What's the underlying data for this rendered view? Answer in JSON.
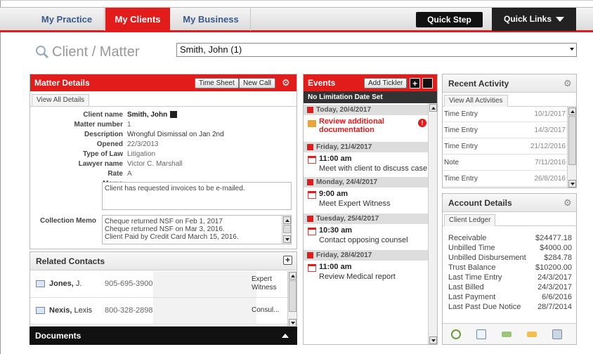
{
  "nav": {
    "tabs": [
      "My Practice",
      "My Clients",
      "My Business"
    ],
    "quick_step": "Quick Step",
    "quick_links": "Quick Links"
  },
  "client_matter": {
    "title": "Client / Matter",
    "value": "Smith, John (1)"
  },
  "matter_details": {
    "title": "Matter Details",
    "time_sheet": "Time Sheet",
    "new_call": "New Call",
    "view_all": "View All Details",
    "client_name_label": "Client name",
    "client_name": "Smith, John",
    "matter_number_label": "Matter number",
    "matter_number": "1",
    "description_label": "Description",
    "description": "Wrongful Dismissal on Jan 2nd",
    "opened_label": "Opened",
    "opened": "22/3/2013",
    "type_label": "Type of Law",
    "type": "Litigation",
    "lawyer_label": "Lawyer name",
    "lawyer": "Victor C. Marshall",
    "rate_label": "Rate",
    "rate": "A",
    "memo_label": "Memo",
    "memo": "Client has requested invoices to be e-mailed.",
    "collection_label": "Collection Memo",
    "collection_lines": [
      "Cheque returned NSF on Feb 1, 2017",
      "Cheque returned NSF on Mar 3, 2016.",
      "Client Paid by Credit Card March 15, 2016."
    ]
  },
  "related_contacts": {
    "title": "Related Contacts",
    "contacts": [
      {
        "last": "Jones,",
        "first": "J.",
        "phone": "905-695-3900",
        "role1": "Expert",
        "role2": "Witness"
      },
      {
        "last": "Nexis,",
        "first": "Lexis",
        "phone": "800-328-2898",
        "role1": "Consul...",
        "role2": ""
      }
    ]
  },
  "documents": {
    "title": "Documents"
  },
  "events": {
    "title": "Events",
    "add_tickler": "Add Tickler",
    "add_icon": "+",
    "limitation": "No Limitation Date Set",
    "days": [
      {
        "date": "Today, 20/4/2017"
      },
      {
        "date": "Friday, 21/4/2017"
      },
      {
        "date": "Monday, 24/4/2017"
      },
      {
        "date": "Tuesday, 25/4/2017"
      },
      {
        "date": "Friday, 28/4/2017"
      }
    ],
    "task": "Review additional documentation",
    "task_l1": "Review additional",
    "task_l2": "documentation",
    "items": [
      {
        "time": "11:00 am",
        "desc": "Meet with client to discuss case"
      },
      {
        "time": "9:00 am",
        "desc": "Meet Expert Witness"
      },
      {
        "time": "10:30 am",
        "desc": "Contact opposing counsel"
      },
      {
        "time": "11:00 am",
        "desc": "Review Medical report"
      }
    ]
  },
  "recent_activity": {
    "title": "Recent Activity",
    "view_all": "View All Activities",
    "rows": [
      {
        "type": "Time Entry",
        "date": "10/1/2017"
      },
      {
        "type": "Time Entry",
        "date": "14/3/2017"
      },
      {
        "type": "Time Entry",
        "date": "21/12/2016"
      },
      {
        "type": "Note",
        "date": "7/11/2016"
      },
      {
        "type": "Time Entry",
        "date": "26/8/2016"
      }
    ]
  },
  "account": {
    "title": "Account Details",
    "tab": "Client Ledger",
    "rows": [
      {
        "label": "Receivable",
        "value": "$24477.18"
      },
      {
        "label": "Unbilled Time",
        "value": "$4000.00"
      },
      {
        "label": "Unbilled Disbursement",
        "value": "$284.78"
      },
      {
        "label": "Trust Balance",
        "value": "$10200.00"
      },
      {
        "label": "Last Time Entry",
        "value": "24/3/2017"
      },
      {
        "label": "Last Billed",
        "value": "24/3/2017"
      },
      {
        "label": "Last Payment",
        "value": "6/6/2016"
      },
      {
        "label": "Last Past Due Notice",
        "value": "28/7/2014"
      }
    ]
  },
  "icons": {
    "gear": "⚙",
    "search": "search-icon"
  },
  "colors": {
    "accent": "#e21b1b",
    "nav_text": "#3a5a8c",
    "dark": "#111111"
  }
}
